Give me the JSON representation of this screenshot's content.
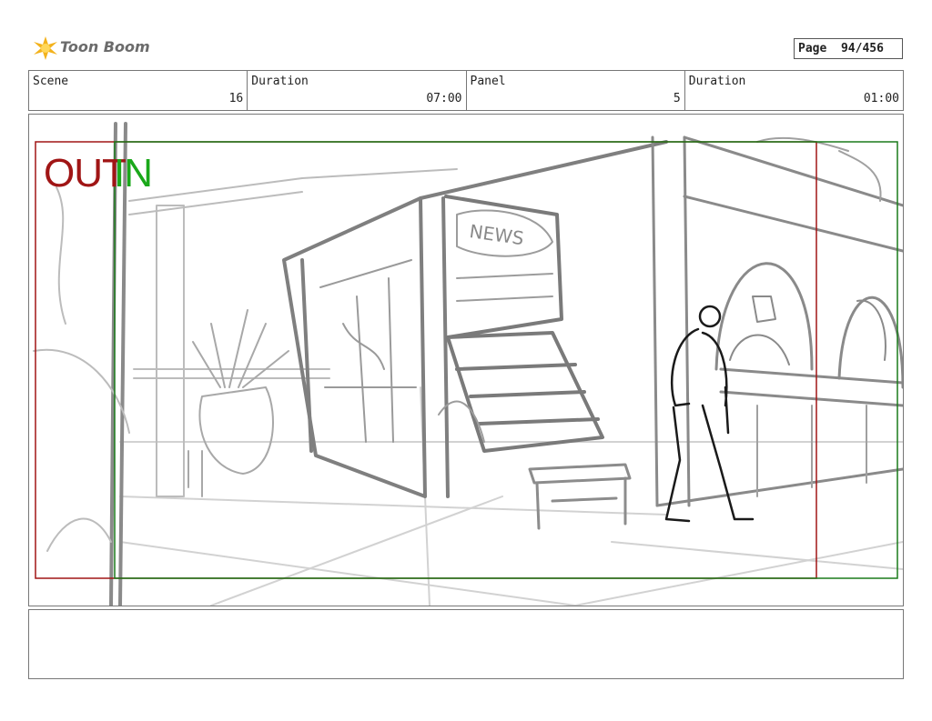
{
  "brand": {
    "name": "Toon Boom"
  },
  "page": {
    "label": "Page",
    "current": "94/456",
    "text": "Page  94/456"
  },
  "header": {
    "scene_label": "Scene",
    "scene_value": "16",
    "duration_label": "Duration",
    "duration_value": "07:00",
    "panel_label": "Panel",
    "panel_value": "5",
    "panel_duration_label": "Duration",
    "panel_duration_value": "01:00"
  },
  "frame": {
    "out_label": "OUT",
    "in_label": "IN",
    "out_color": "#a01515",
    "in_color": "#1aa81a"
  },
  "sketch": {
    "sign_text": "NEWS"
  },
  "notes": {
    "text": ""
  }
}
